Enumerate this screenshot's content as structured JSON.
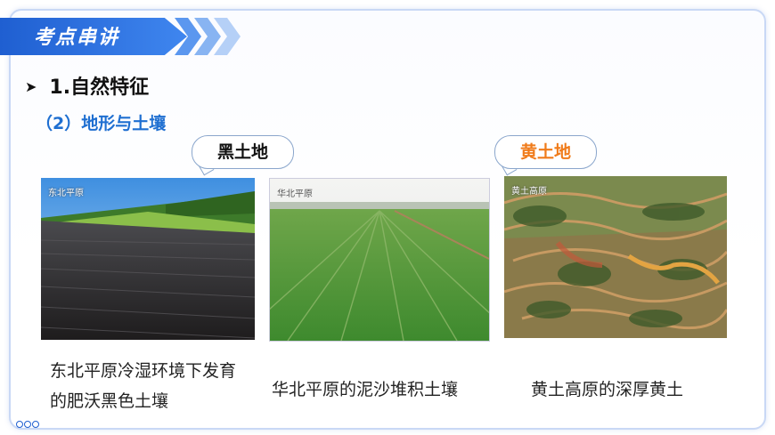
{
  "header": {
    "title": "考点串讲"
  },
  "section": {
    "heading": "1.自然特征",
    "subheading": "（2）地形与土壤"
  },
  "bubbles": {
    "black_soil": "黑土地",
    "yellow_soil": "黄土地"
  },
  "photos": [
    {
      "label": "东北平原",
      "caption": "东北平原冷湿环境下发育的肥沃黑色土壤"
    },
    {
      "label": "华北平原",
      "caption": "华北平原的泥沙堆积土壤"
    },
    {
      "label": "黄土高原",
      "caption": "黄土高原的深厚黄土"
    }
  ],
  "colors": {
    "accent": "#1f5fd1",
    "subheading": "#1f6fd1",
    "yellow_soil": "#f07b1a"
  }
}
